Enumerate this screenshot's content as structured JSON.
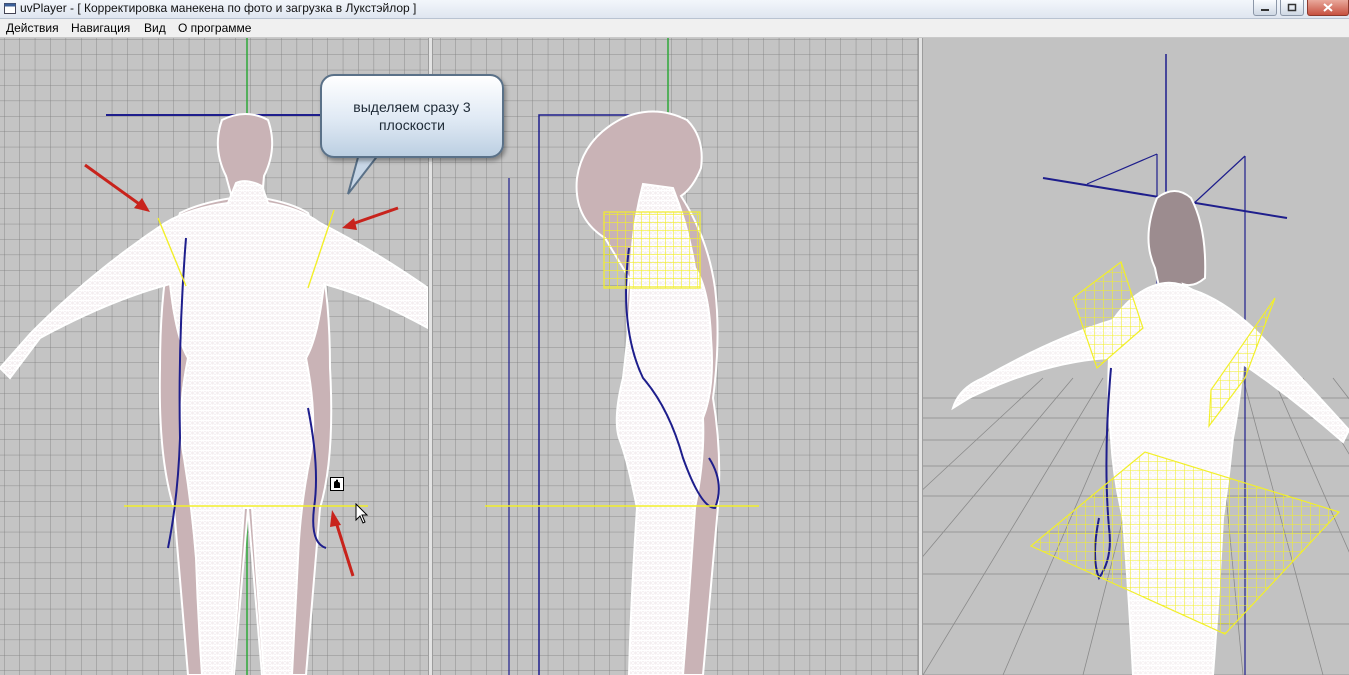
{
  "window": {
    "title": "uvPlayer - [ Корректировка манекена по фото и загрузка в Лукстэйлор ]",
    "app_icon": "window-icon",
    "buttons": [
      "minimize-icon",
      "maximize-icon",
      "close-icon"
    ]
  },
  "menu": {
    "items": [
      "Действия",
      "Навигация",
      "Вид",
      "О программе"
    ]
  },
  "annotation": {
    "callout_text": "выделяем сразу 3 плоскости"
  },
  "colors": {
    "grid_bg": "#c4c4c4",
    "grid_line": "#7d7d7d",
    "mesh": "#ffffff",
    "body_shadow": "#c9b3b6",
    "plane": "#f2ef2a",
    "axis_blue": "#1e1e8c",
    "axis_green": "#2fa83a",
    "arrow_red": "#c8231c"
  }
}
